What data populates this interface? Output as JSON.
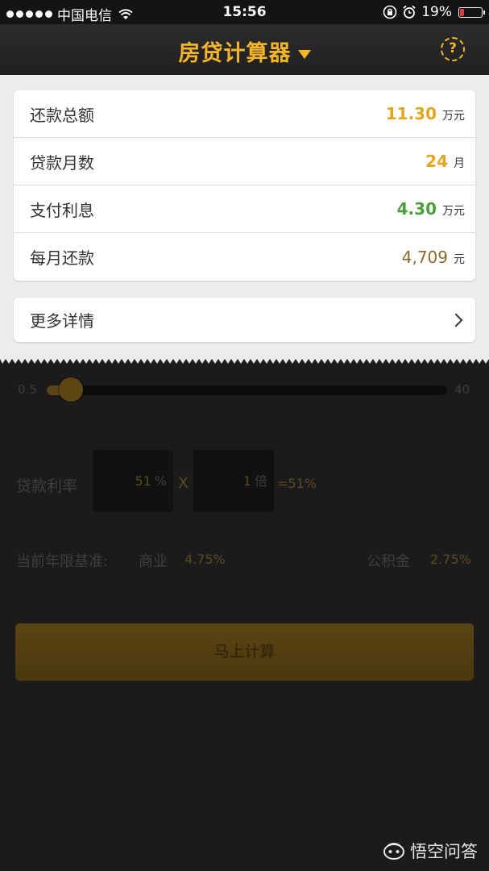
{
  "status_bar": {
    "carrier": "中国电信",
    "time": "15:56",
    "battery_percent": "19%",
    "battery_level": 0.19
  },
  "nav": {
    "title": "房贷计算器",
    "help_label": "?"
  },
  "results": [
    {
      "label": "还款总额",
      "value": "11.30",
      "unit": "万元",
      "color": "#e4a51c"
    },
    {
      "label": "贷款月数",
      "value": "24",
      "unit": "月",
      "color": "#e4a51c"
    },
    {
      "label": "支付利息",
      "value": "4.30",
      "unit": "万元",
      "color": "#4a9e3c"
    },
    {
      "label": "每月还款",
      "value": "4,709",
      "unit": "元",
      "color": "#8a6a2c"
    }
  ],
  "more_details": {
    "label": "更多详情"
  },
  "slider": {
    "min_label": "0.5",
    "max_label": "40",
    "value_fraction": 0.06
  },
  "rate": {
    "label": "贷款利率",
    "rate_value": "51",
    "rate_unit": "%",
    "operator": "X",
    "multiplier_value": "1",
    "multiplier_unit": "倍",
    "result": "=51%"
  },
  "base_rate": {
    "label": "当前年限基准:",
    "commercial_label": "商业",
    "commercial_rate": "4.75%",
    "fund_label": "公积金",
    "fund_rate": "2.75%"
  },
  "calc_button": {
    "label": "马上计算"
  },
  "watermark": {
    "text": "悟空问答"
  }
}
